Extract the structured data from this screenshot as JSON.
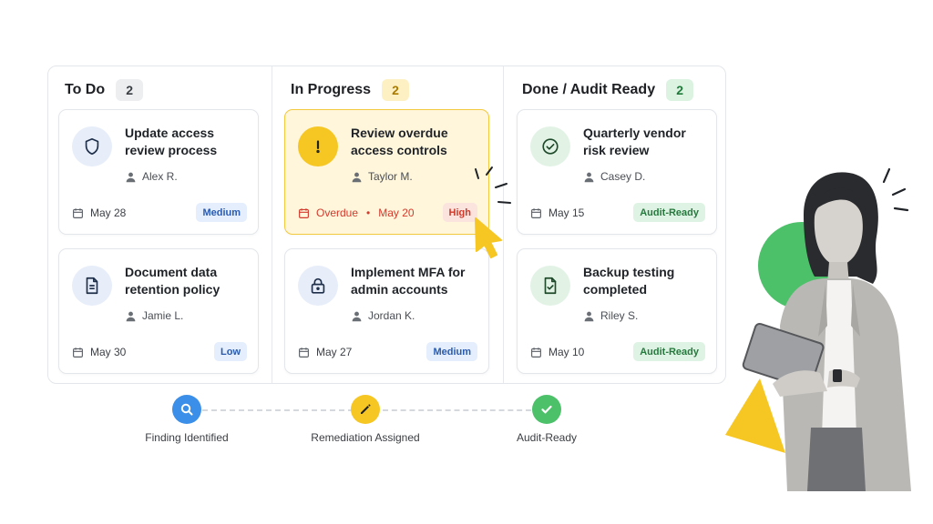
{
  "columns": [
    {
      "title": "To Do",
      "count": "2",
      "cards": [
        {
          "title": "Update access review process",
          "assignee": "Alex R.",
          "date": "May 28",
          "priority": "Medium",
          "icon": "shield-icon"
        },
        {
          "title": "Document data retention policy",
          "assignee": "Jamie L.",
          "date": "May 30",
          "priority": "Low",
          "icon": "document-icon"
        }
      ]
    },
    {
      "title": "In Progress",
      "count": "2",
      "cards": [
        {
          "title": "Review overdue access controls",
          "assignee": "Taylor M.",
          "status": "Overdue",
          "date": "May 20",
          "priority": "High",
          "icon": "alert-icon"
        },
        {
          "title": "Implement MFA for admin accounts",
          "assignee": "Jordan K.",
          "date": "May 27",
          "priority": "Medium",
          "icon": "lock-icon"
        }
      ]
    },
    {
      "title": "Done / Audit Ready",
      "count": "2",
      "cards": [
        {
          "title": "Quarterly vendor risk review",
          "assignee": "Casey D.",
          "date": "May 15",
          "priority": "Audit-Ready",
          "icon": "check-circle-icon"
        },
        {
          "title": "Backup testing completed",
          "assignee": "Riley S.",
          "date": "May 10",
          "priority": "Audit-Ready",
          "icon": "document-check-icon"
        }
      ]
    }
  ],
  "workflow": {
    "steps": [
      {
        "label": "Finding Identified",
        "icon": "search-icon",
        "color": "#3b8fe8"
      },
      {
        "label": "Remediation Assigned",
        "icon": "pencil-icon",
        "color": "#f6c623"
      },
      {
        "label": "Audit-Ready",
        "icon": "check-icon",
        "color": "#4cc16a"
      }
    ]
  },
  "colors": {
    "accent_yellow": "#f6c623",
    "accent_green": "#4cc16a",
    "overdue_red": "#d33a2c",
    "badge_blue": "#2a5bb0"
  }
}
